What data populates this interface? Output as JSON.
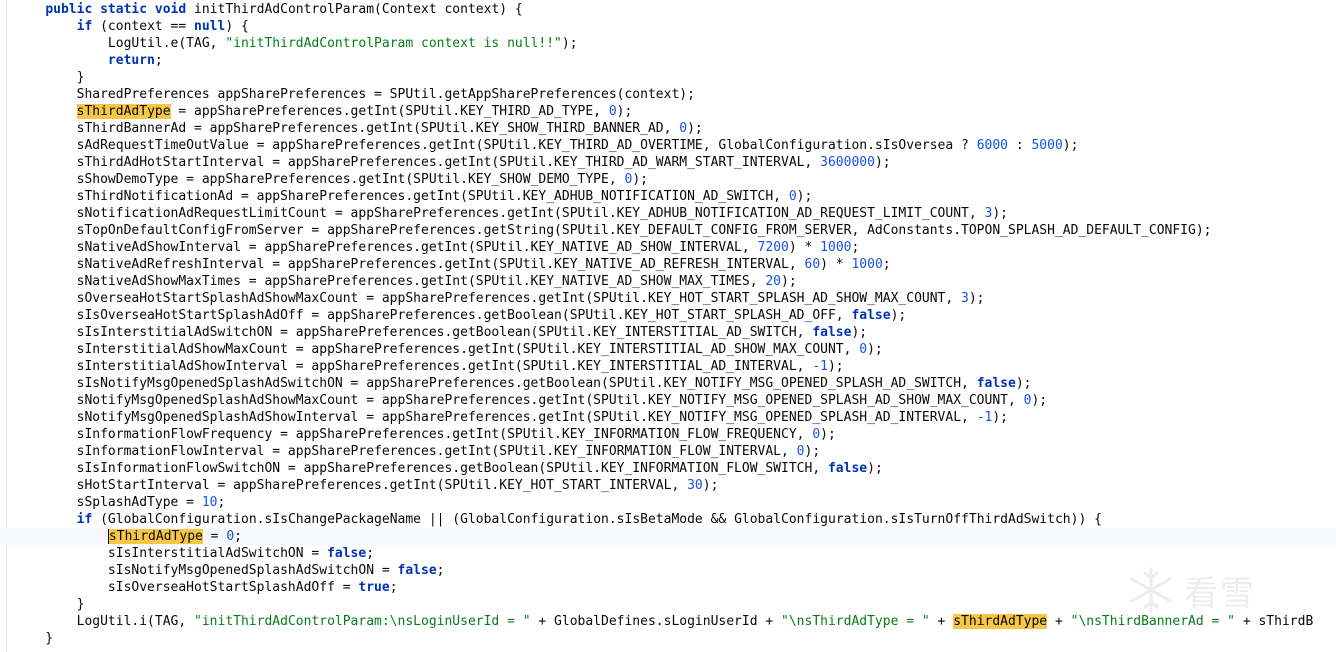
{
  "editor": {
    "lines": [
      [
        [
          "t",
          "    "
        ],
        [
          "kw",
          "public static void "
        ],
        [
          "t",
          "initThirdAdControlParam(Context context) {"
        ]
      ],
      [
        [
          "t",
          "        "
        ],
        [
          "kw",
          "if"
        ],
        [
          "t",
          " (context == "
        ],
        [
          "kw",
          "null"
        ],
        [
          "t",
          ") {"
        ]
      ],
      [
        [
          "t",
          "            LogUtil.e(TAG, "
        ],
        [
          "str",
          "\"initThirdAdControlParam context is null!!\""
        ],
        [
          "t",
          ");"
        ]
      ],
      [
        [
          "t",
          "            "
        ],
        [
          "kw",
          "return"
        ],
        [
          "t",
          ";"
        ]
      ],
      [
        [
          "t",
          "        }"
        ]
      ],
      [
        [
          "t",
          "        SharedPreferences appSharePreferences = SPUtil.getAppSharePreferences(context);"
        ]
      ],
      [
        [
          "t",
          "        "
        ],
        [
          "hl",
          "sThirdAdType"
        ],
        [
          "t",
          " = appSharePreferences.getInt(SPUtil.KEY_THIRD_AD_TYPE, "
        ],
        [
          "num",
          "0"
        ],
        [
          "t",
          ");"
        ]
      ],
      [
        [
          "t",
          "        sThirdBannerAd = appSharePreferences.getInt(SPUtil.KEY_SHOW_THIRD_BANNER_AD, "
        ],
        [
          "num",
          "0"
        ],
        [
          "t",
          ");"
        ]
      ],
      [
        [
          "t",
          "        sAdRequestTimeOutValue = appSharePreferences.getInt(SPUtil.KEY_THIRD_AD_OVERTIME, GlobalConfiguration.sIsOversea ? "
        ],
        [
          "num",
          "6000"
        ],
        [
          "t",
          " : "
        ],
        [
          "num",
          "5000"
        ],
        [
          "t",
          ");"
        ]
      ],
      [
        [
          "t",
          "        sThirdAdHotStartInterval = appSharePreferences.getInt(SPUtil.KEY_THIRD_AD_WARM_START_INTERVAL, "
        ],
        [
          "num",
          "3600000"
        ],
        [
          "t",
          ");"
        ]
      ],
      [
        [
          "t",
          "        sShowDemoType = appSharePreferences.getInt(SPUtil.KEY_SHOW_DEMO_TYPE, "
        ],
        [
          "num",
          "0"
        ],
        [
          "t",
          ");"
        ]
      ],
      [
        [
          "t",
          "        sThirdNotificationAd = appSharePreferences.getInt(SPUtil.KEY_ADHUB_NOTIFICATION_AD_SWITCH, "
        ],
        [
          "num",
          "0"
        ],
        [
          "t",
          ");"
        ]
      ],
      [
        [
          "t",
          "        sNotificationAdRequestLimitCount = appSharePreferences.getInt(SPUtil.KEY_ADHUB_NOTIFICATION_AD_REQUEST_LIMIT_COUNT, "
        ],
        [
          "num",
          "3"
        ],
        [
          "t",
          ");"
        ]
      ],
      [
        [
          "t",
          "        sTopOnDefaultConfigFromServer = appSharePreferences.getString(SPUtil.KEY_DEFAULT_CONFIG_FROM_SERVER, AdConstants.TOPON_SPLASH_AD_DEFAULT_CONFIG);"
        ]
      ],
      [
        [
          "t",
          "        sNativeAdShowInterval = appSharePreferences.getInt(SPUtil.KEY_NATIVE_AD_SHOW_INTERVAL, "
        ],
        [
          "num",
          "7200"
        ],
        [
          "t",
          ") * "
        ],
        [
          "num",
          "1000"
        ],
        [
          "t",
          ";"
        ]
      ],
      [
        [
          "t",
          "        sNativeAdRefreshInterval = appSharePreferences.getInt(SPUtil.KEY_NATIVE_AD_REFRESH_INTERVAL, "
        ],
        [
          "num",
          "60"
        ],
        [
          "t",
          ") * "
        ],
        [
          "num",
          "1000"
        ],
        [
          "t",
          ";"
        ]
      ],
      [
        [
          "t",
          "        sNativeAdShowMaxTimes = appSharePreferences.getInt(SPUtil.KEY_NATIVE_AD_SHOW_MAX_TIMES, "
        ],
        [
          "num",
          "20"
        ],
        [
          "t",
          ");"
        ]
      ],
      [
        [
          "t",
          "        sOverseaHotStartSplashAdShowMaxCount = appSharePreferences.getInt(SPUtil.KEY_HOT_START_SPLASH_AD_SHOW_MAX_COUNT, "
        ],
        [
          "num",
          "3"
        ],
        [
          "t",
          ");"
        ]
      ],
      [
        [
          "t",
          "        sIsOverseaHotStartSplashAdOff = appSharePreferences.getBoolean(SPUtil.KEY_HOT_START_SPLASH_AD_OFF, "
        ],
        [
          "kw",
          "false"
        ],
        [
          "t",
          ");"
        ]
      ],
      [
        [
          "t",
          "        sIsInterstitialAdSwitchON = appSharePreferences.getBoolean(SPUtil.KEY_INTERSTITIAL_AD_SWITCH, "
        ],
        [
          "kw",
          "false"
        ],
        [
          "t",
          ");"
        ]
      ],
      [
        [
          "t",
          "        sInterstitialAdShowMaxCount = appSharePreferences.getInt(SPUtil.KEY_INTERSTITIAL_AD_SHOW_MAX_COUNT, "
        ],
        [
          "num",
          "0"
        ],
        [
          "t",
          ");"
        ]
      ],
      [
        [
          "t",
          "        sInterstitialAdShowInterval = appSharePreferences.getInt(SPUtil.KEY_INTERSTITIAL_AD_INTERVAL, "
        ],
        [
          "num",
          "-1"
        ],
        [
          "t",
          ");"
        ]
      ],
      [
        [
          "t",
          "        sIsNotifyMsgOpenedSplashAdSwitchON = appSharePreferences.getBoolean(SPUtil.KEY_NOTIFY_MSG_OPENED_SPLASH_AD_SWITCH, "
        ],
        [
          "kw",
          "false"
        ],
        [
          "t",
          ");"
        ]
      ],
      [
        [
          "t",
          "        sNotifyMsgOpenedSplashAdShowMaxCount = appSharePreferences.getInt(SPUtil.KEY_NOTIFY_MSG_OPENED_SPLASH_AD_SHOW_MAX_COUNT, "
        ],
        [
          "num",
          "0"
        ],
        [
          "t",
          ");"
        ]
      ],
      [
        [
          "t",
          "        sNotifyMsgOpenedSplashAdShowInterval = appSharePreferences.getInt(SPUtil.KEY_NOTIFY_MSG_OPENED_SPLASH_AD_INTERVAL, "
        ],
        [
          "num",
          "-1"
        ],
        [
          "t",
          ");"
        ]
      ],
      [
        [
          "t",
          "        sInformationFlowFrequency = appSharePreferences.getInt(SPUtil.KEY_INFORMATION_FLOW_FREQUENCY, "
        ],
        [
          "num",
          "0"
        ],
        [
          "t",
          ");"
        ]
      ],
      [
        [
          "t",
          "        sInformationFlowInterval = appSharePreferences.getInt(SPUtil.KEY_INFORMATION_FLOW_INTERVAL, "
        ],
        [
          "num",
          "0"
        ],
        [
          "t",
          ");"
        ]
      ],
      [
        [
          "t",
          "        sIsInformationFlowSwitchON = appSharePreferences.getBoolean(SPUtil.KEY_INFORMATION_FLOW_SWITCH, "
        ],
        [
          "kw",
          "false"
        ],
        [
          "t",
          ");"
        ]
      ],
      [
        [
          "t",
          "        sHotStartInterval = appSharePreferences.getInt(SPUtil.KEY_HOT_START_INTERVAL, "
        ],
        [
          "num",
          "30"
        ],
        [
          "t",
          ");"
        ]
      ],
      [
        [
          "t",
          "        sSplashAdType = "
        ],
        [
          "num",
          "10"
        ],
        [
          "t",
          ";"
        ]
      ],
      [
        [
          "t",
          "        "
        ],
        [
          "kw",
          "if"
        ],
        [
          "t",
          " (GlobalConfiguration.sIsChangePackageName || (GlobalConfiguration.sIsBetaMode && GlobalConfiguration.sIsTurnOffThirdAdSwitch)) {"
        ]
      ],
      [
        [
          "t",
          "            "
        ],
        [
          "hlc",
          "sThirdAdType"
        ],
        [
          "t",
          " = "
        ],
        [
          "num",
          "0"
        ],
        [
          "t",
          ";"
        ]
      ],
      [
        [
          "t",
          "            sIsInterstitialAdSwitchON = "
        ],
        [
          "kw",
          "false"
        ],
        [
          "t",
          ";"
        ]
      ],
      [
        [
          "t",
          "            sIsNotifyMsgOpenedSplashAdSwitchON = "
        ],
        [
          "kw",
          "false"
        ],
        [
          "t",
          ";"
        ]
      ],
      [
        [
          "t",
          "            sIsOverseaHotStartSplashAdOff = "
        ],
        [
          "kw",
          "true"
        ],
        [
          "t",
          ";"
        ]
      ],
      [
        [
          "t",
          "        }"
        ]
      ],
      [
        [
          "t",
          "        LogUtil.i(TAG, "
        ],
        [
          "str",
          "\"initThirdAdControlParam:\\nsLoginUserId = \""
        ],
        [
          "t",
          " + GlobalDefines.sLoginUserId + "
        ],
        [
          "str",
          "\"\\nsThirdAdType = \""
        ],
        [
          "t",
          " + "
        ],
        [
          "hl",
          "sThirdAdType"
        ],
        [
          "t",
          " + "
        ],
        [
          "str",
          "\"\\nsThirdBannerAd = \""
        ],
        [
          "t",
          " + sThirdB"
        ]
      ],
      [
        [
          "t",
          "    }"
        ]
      ]
    ],
    "current_line_index": 31
  },
  "watermark": {
    "text": "看雪",
    "icon": "snowflake-icon",
    "color": "#bcbcbc"
  },
  "colors": {
    "keyword": "#0033b3",
    "string": "#067d17",
    "number": "#1750eb",
    "highlight": "#f6c744",
    "current_line": "#f5f8fe"
  }
}
